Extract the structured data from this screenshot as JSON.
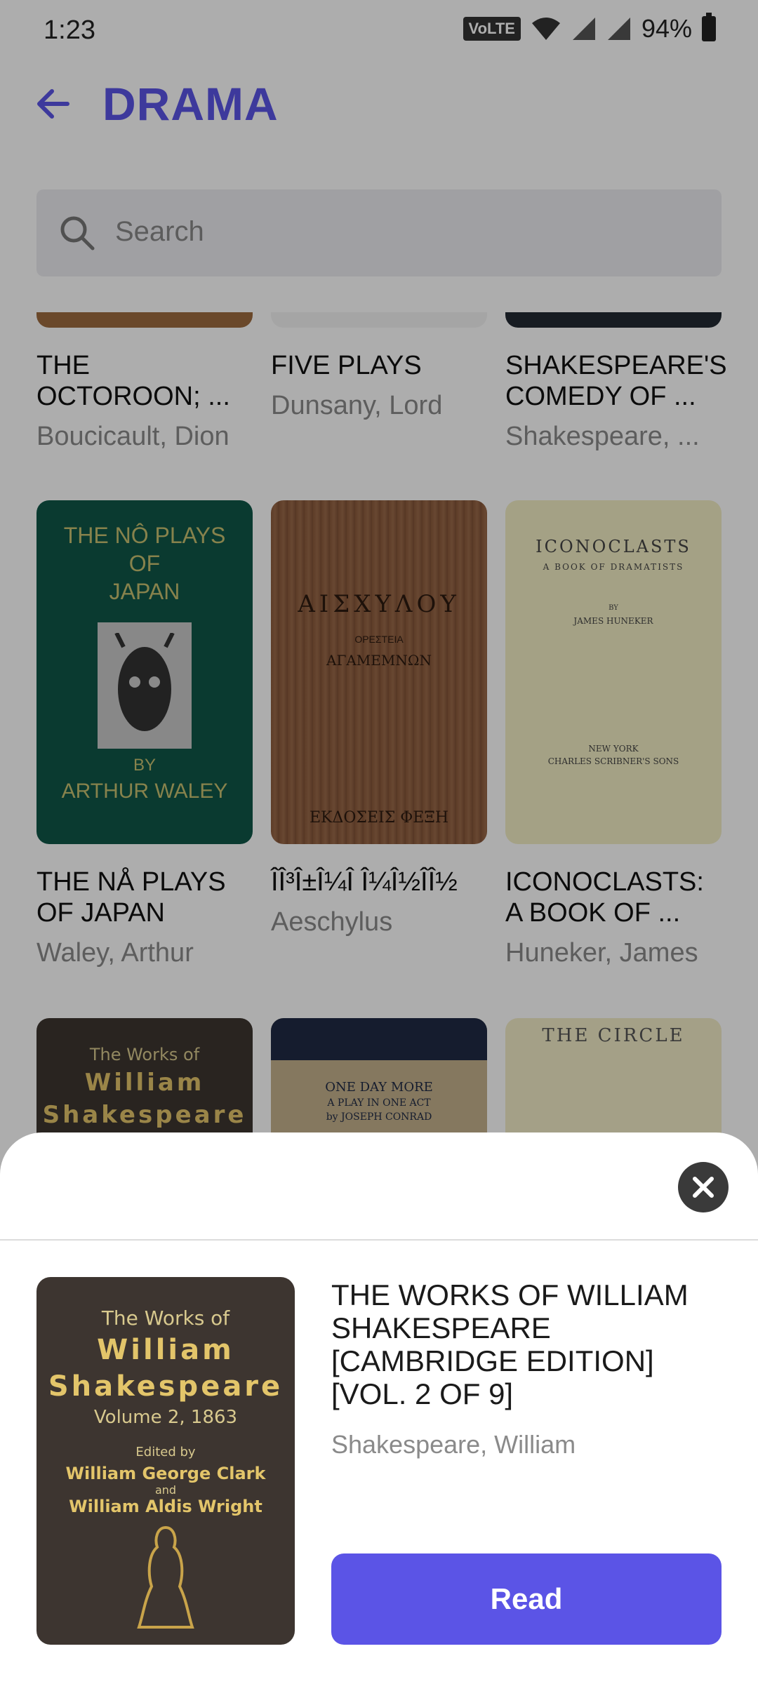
{
  "status_bar": {
    "time": "1:23",
    "network": "VoLTE",
    "battery": "94%"
  },
  "header": {
    "title": "DRAMA"
  },
  "search": {
    "placeholder": "Search"
  },
  "books": [
    {
      "title": "THE OCTOROON; ...",
      "author": "Boucicault, Dion"
    },
    {
      "title": "FIVE PLAYS",
      "author": "Dunsany, Lord"
    },
    {
      "title": "SHAKESPEARE'S COMEDY OF ...",
      "author": "Shakespeare, ..."
    },
    {
      "title": "THE NÅ PLAYS OF JAPAN",
      "author": "Waley, Arthur"
    },
    {
      "title": "îî³î±î¼î î¼î½îî½",
      "author": "Aeschylus"
    },
    {
      "title": "ICONOCLASTS: A BOOK OF ...",
      "author": "Huneker, James"
    }
  ],
  "covers": {
    "no_plays": [
      "THE NÔ PLAYS",
      "OF",
      "JAPAN",
      "BY",
      "ARTHUR WALEY"
    ],
    "aeschylus": [
      "ΑΙΣΧΥΛΟΥ",
      "ΟΡΕΣΤΕΙΑ",
      "ΑΓΑΜΕΜΝΩΝ",
      "ΕΚΔΟΣΕΙΣ ΦΕΞΗ"
    ],
    "iconoclasts": [
      "ICONOCLASTS",
      "A BOOK OF DRAMATISTS",
      "BY",
      "JAMES HUNEKER",
      "NEW YORK",
      "CHARLES SCRIBNER'S SONS"
    ],
    "row3a": [
      "The Works of",
      "William",
      "Shakespeare"
    ],
    "row3b": [
      "ONE DAY MORE",
      "A PLAY IN ONE ACT",
      "by JOSEPH CONRAD"
    ],
    "row3c": [
      "THE CIRCLE"
    ]
  },
  "sheet": {
    "title": "THE WORKS OF WILLIAM SHAKESPEARE [CAMBRIDGE EDITION] [VOL. 2 OF 9]",
    "author": "Shakespeare, William",
    "read_label": "Read",
    "cover": {
      "l1": "The Works of",
      "l2": "William",
      "l3": "Shakespeare",
      "l4": "Volume 2, 1863",
      "l5": "Edited by",
      "l6": "William George Clark",
      "l7": "and",
      "l8": "William Aldis Wright"
    }
  }
}
